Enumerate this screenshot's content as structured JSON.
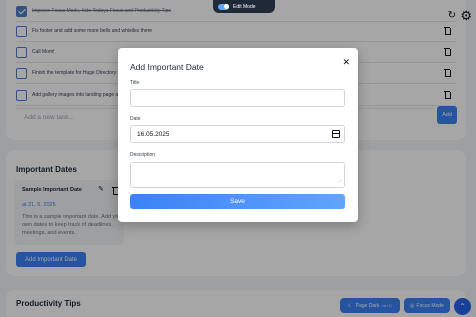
{
  "edit_mode": {
    "label": "Edit Mode",
    "enabled": true
  },
  "tasks": {
    "items": [
      {
        "text": "Improve Focus Mode, hide Todays Focus and Productivity Tips",
        "done": true
      },
      {
        "text": "Fix footer and add some more bells and whistles there",
        "done": false
      },
      {
        "text": "Call Mom!",
        "done": false
      },
      {
        "text": "Finish the template for Huge Directory at",
        "done": false
      },
      {
        "text": "Add gallery images into landing page and",
        "done": false
      }
    ],
    "new_task_placeholder": "Add a new task...",
    "add_label": "Add"
  },
  "important_dates": {
    "heading": "Important Dates",
    "item": {
      "title": "Sample Important Date",
      "date": "at 21. 5. 2025",
      "description": "This is a sample important date. Add your own dates to keep track of deadlines, meetings, and events."
    },
    "add_button": "Add Important Date"
  },
  "productivity_tips": {
    "heading": "Productivity Tips",
    "page_dark_label": "Page Dark",
    "page_dark_shortcut": "ctrl D",
    "focus_mode_label": "Focus Mode"
  },
  "modal": {
    "title": "Add Important Date",
    "title_label": "Title",
    "title_value": "",
    "date_label": "Date",
    "date_value": "16.05.2025",
    "description_label": "Description",
    "description_value": "",
    "save_label": "Save"
  },
  "colors": {
    "accent": "#3b82f6",
    "overlay": "rgba(0,0,0,0.35)"
  }
}
